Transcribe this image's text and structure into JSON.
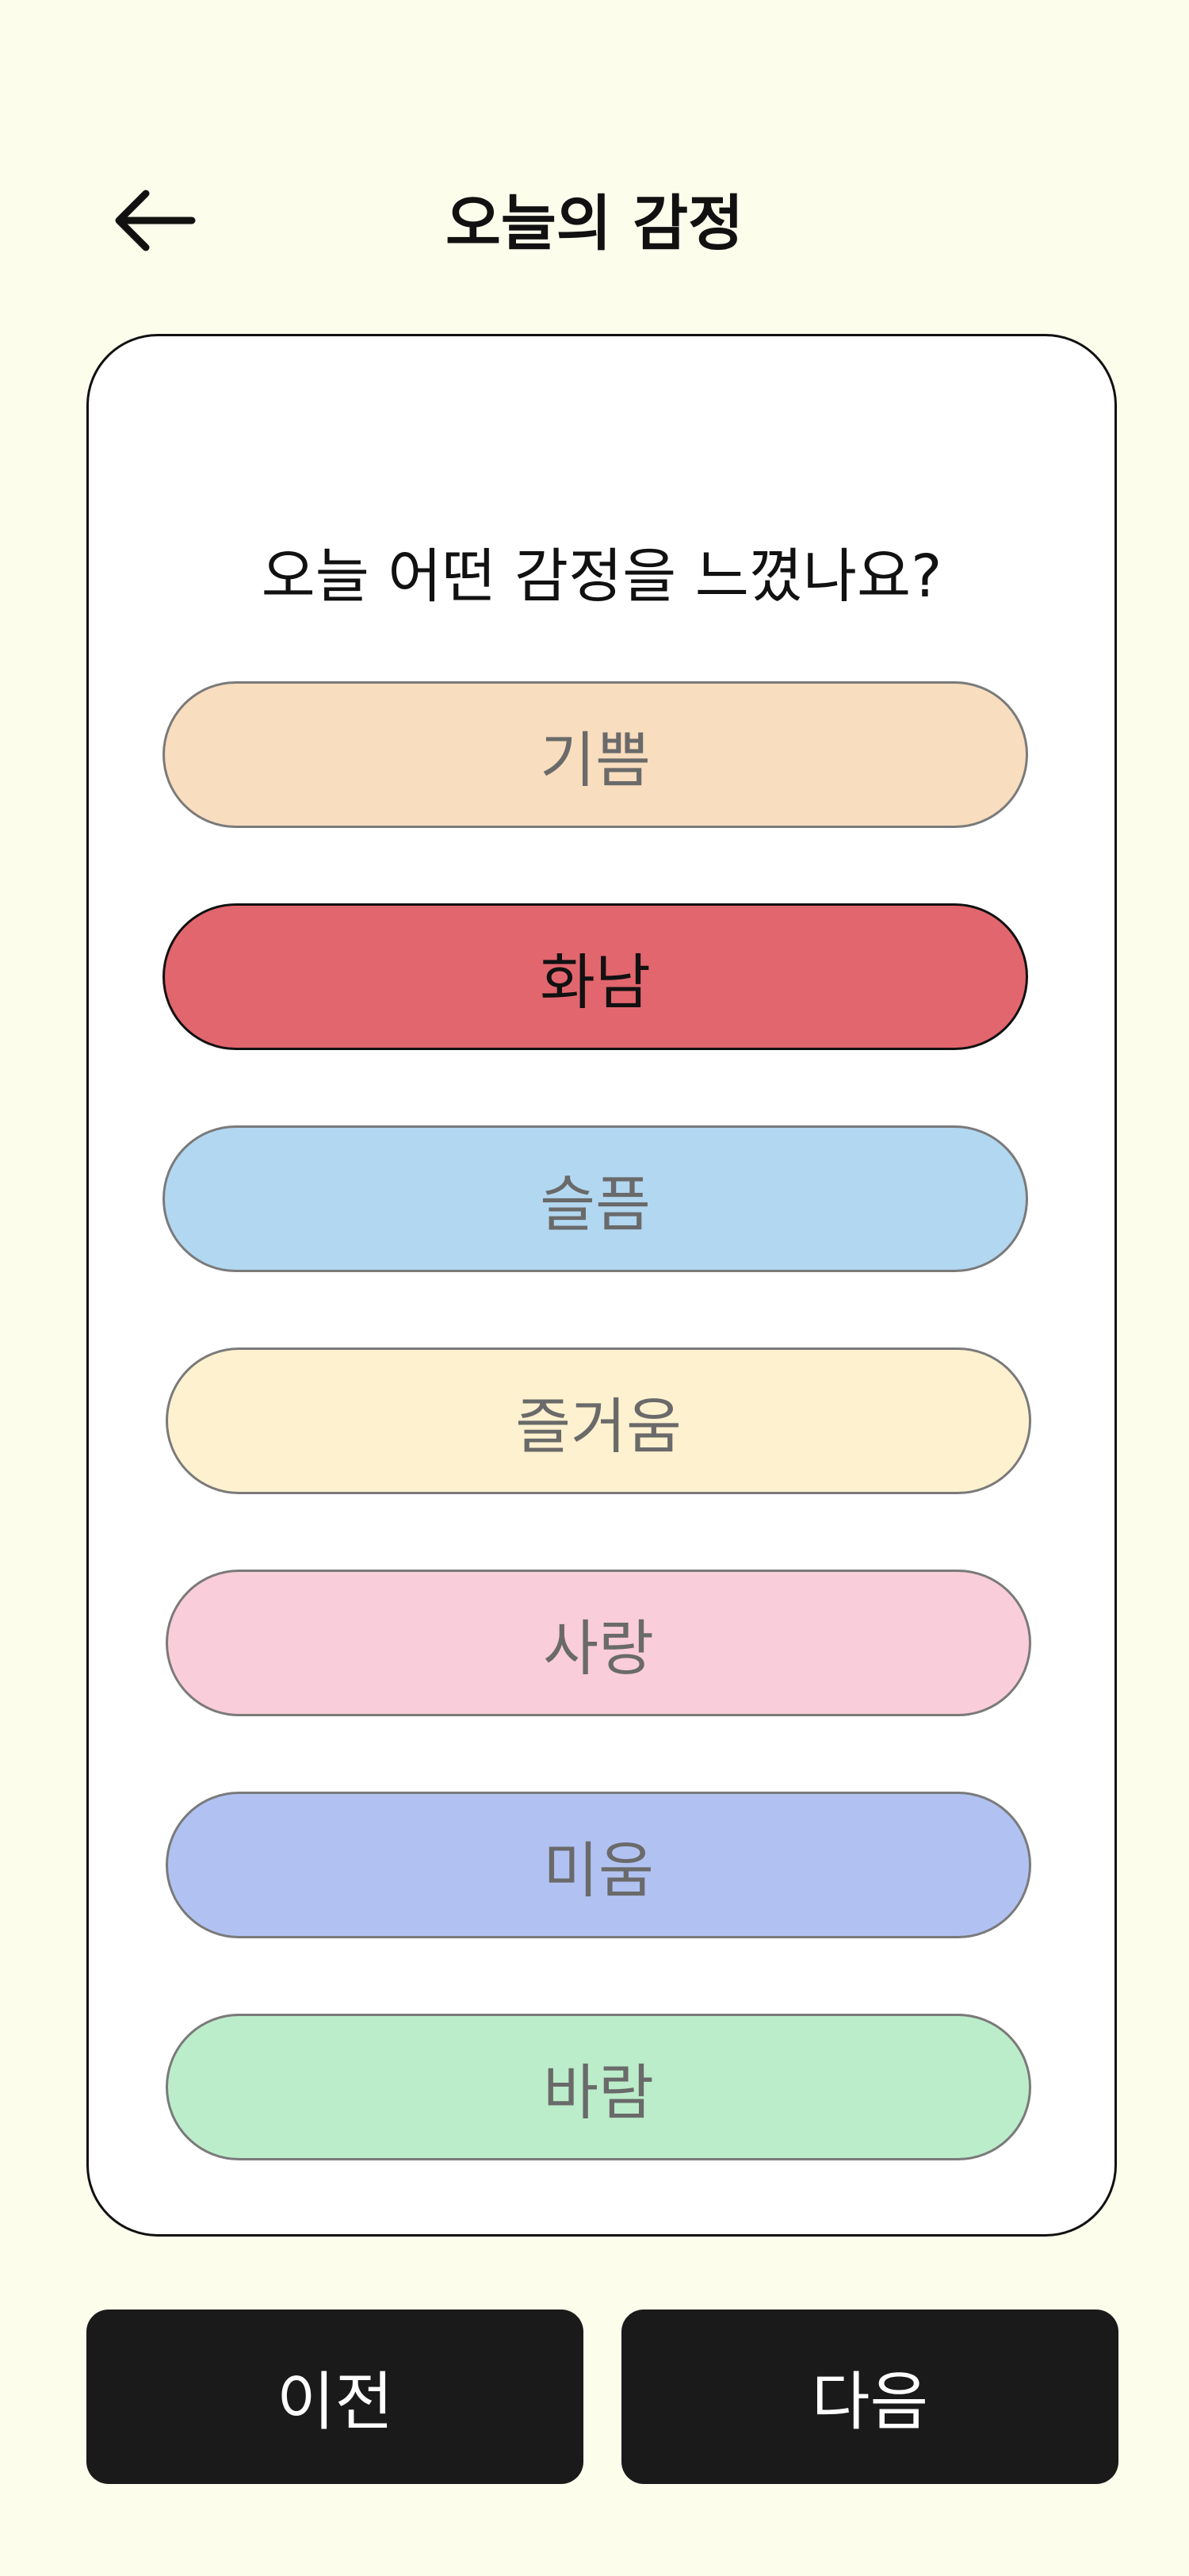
{
  "header": {
    "title": "오늘의 감정",
    "back_icon": "arrow-left-icon"
  },
  "card": {
    "question": "오늘 어떤 감정을 느꼈나요?",
    "selected": "화남",
    "options": [
      {
        "label": "기쁨",
        "color": "#f8ddbe"
      },
      {
        "label": "화남",
        "color": "#e2666e"
      },
      {
        "label": "슬픔",
        "color": "#b2d7f1"
      },
      {
        "label": "즐거움",
        "color": "#fdf1cf"
      },
      {
        "label": "사랑",
        "color": "#f9cdd9"
      },
      {
        "label": "미움",
        "color": "#b1c2f2"
      },
      {
        "label": "바람",
        "color": "#bcedca"
      }
    ]
  },
  "footer": {
    "prev_label": "이전",
    "next_label": "다음"
  }
}
